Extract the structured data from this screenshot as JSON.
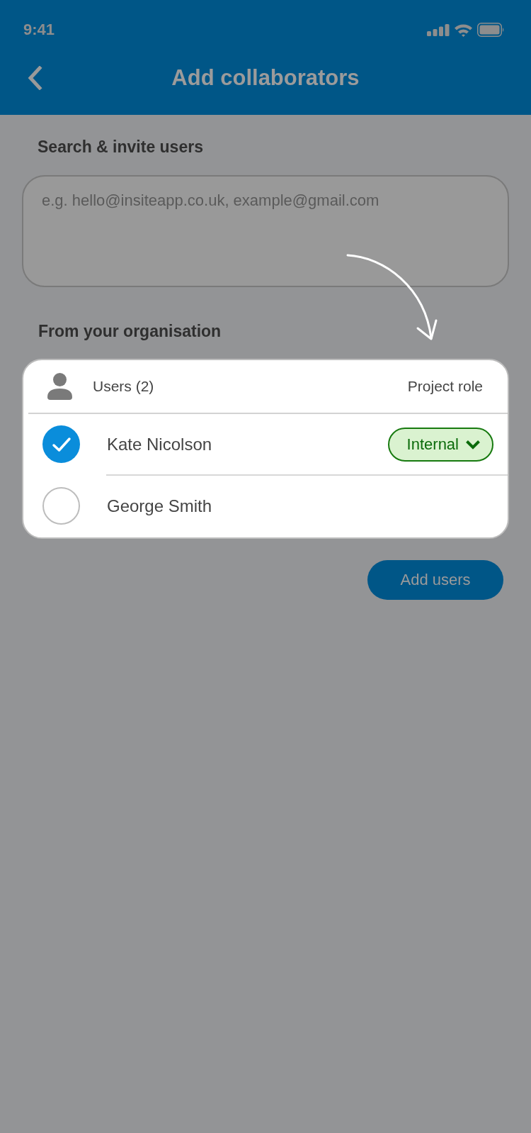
{
  "status_bar": {
    "time": "9:41"
  },
  "nav_bar": {
    "title": "Add collaborators"
  },
  "invite": {
    "heading": "Search & invite users",
    "placeholder": "e.g. hello@insiteapp.co.uk, example@gmail.com"
  },
  "organisation": {
    "heading": "From your organisation",
    "columns": [
      "Users (2)",
      "Project role"
    ],
    "users": [
      {
        "name": "Kate Nicolson",
        "selected": true,
        "role": "Internal"
      },
      {
        "name": "George Smith",
        "selected": false
      }
    ]
  },
  "add_button": {
    "label": "Add users"
  }
}
